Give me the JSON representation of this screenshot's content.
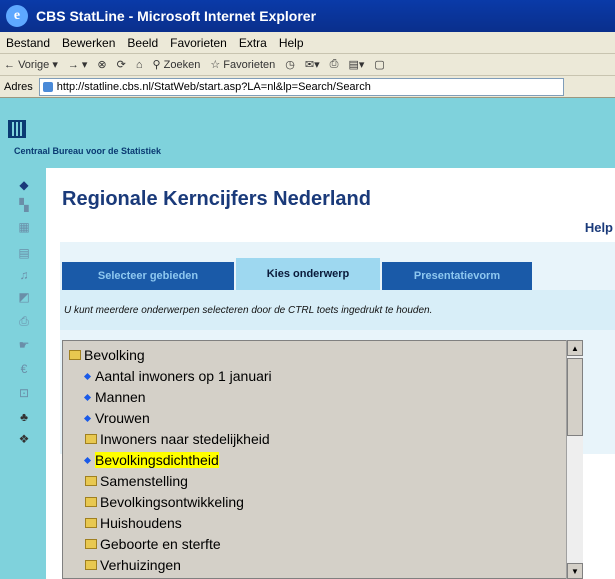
{
  "window": {
    "title": "CBS StatLine - Microsoft Internet Explorer"
  },
  "menu": [
    "Bestand",
    "Bewerken",
    "Beeld",
    "Favorieten",
    "Extra",
    "Help"
  ],
  "toolbar": {
    "back_label": "Vorige",
    "search_label": "Zoeken",
    "favorites_label": "Favorieten"
  },
  "address": {
    "label": "Adres",
    "url": "http://statline.cbs.nl/StatWeb/start.asp?LA=nl&lp=Search/Search"
  },
  "site": {
    "org_name": "Centraal Bureau voor de Statistiek"
  },
  "page": {
    "title": "Regionale Kerncijfers Nederland",
    "help_label": "Help"
  },
  "tabs": [
    {
      "label": "Selecteer gebieden",
      "active": false
    },
    {
      "label": "Kies onderwerp",
      "active": true
    },
    {
      "label": "Presentatievorm",
      "active": false
    }
  ],
  "instruction": "U kunt meerdere onderwerpen selecteren door de CTRL toets ingedrukt te houden.",
  "tree": {
    "root": "Bevolking",
    "items": [
      {
        "label": "Aantal inwoners op 1 januari",
        "kind": "leaf",
        "selected": false
      },
      {
        "label": "Mannen",
        "kind": "leaf",
        "selected": false
      },
      {
        "label": "Vrouwen",
        "kind": "leaf",
        "selected": false
      },
      {
        "label": "Inwoners naar stedelijkheid",
        "kind": "folder",
        "selected": false
      },
      {
        "label": "Bevolkingsdichtheid",
        "kind": "leaf",
        "selected": true
      },
      {
        "label": "Samenstelling",
        "kind": "folder",
        "selected": false
      },
      {
        "label": "Bevolkingsontwikkeling",
        "kind": "folder",
        "selected": false
      },
      {
        "label": "Huishoudens",
        "kind": "folder",
        "selected": false
      },
      {
        "label": "Geboorte en sterfte",
        "kind": "folder",
        "selected": false
      },
      {
        "label": "Verhuizingen",
        "kind": "folder",
        "selected": false
      }
    ]
  },
  "colors": {
    "accent": "#1a3a7a",
    "tab_inactive": "#1a5aa8",
    "tab_active": "#9ed8f0",
    "site_band": "#7fd2dc",
    "selection": "#ffff00"
  }
}
